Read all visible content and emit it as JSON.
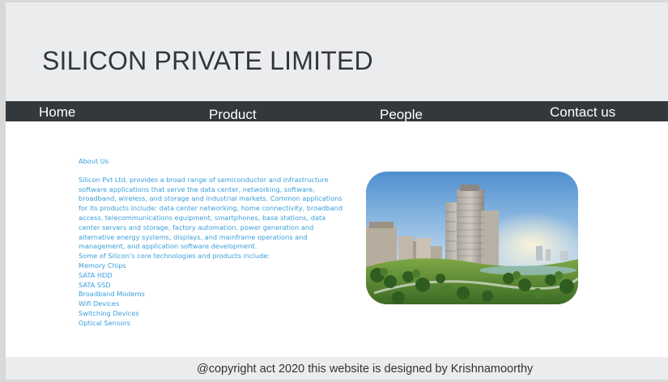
{
  "header": {
    "title": "SILICON PRIVATE LIMITED"
  },
  "nav": {
    "home": "Home",
    "product": "Product",
    "people": "People",
    "contact": "Contact us"
  },
  "about": {
    "title": "About Us",
    "description": "Silicon Pvt Ltd, provides a broad range of semiconductor and infrastructure software applications that serve the data center, networking, software, broadband, wireless, and storage and industrial markets. Common applications for its products include: data center networking, home connectivity, broadband access, telecommunications equipment, smartphones, base stations, data center servers and storage, factory automation, power generation and alternative energy systems, displays, and mainframe operations and management, and application software development.",
    "tech_intro": "Some of Silicon's core technologies and products include:",
    "technologies": [
      "Memory Chips",
      "SATA HDD",
      "SATA SSD",
      "Broadband Modems",
      "Wifi Devices",
      "Switching Devices",
      "Optical Sensors"
    ]
  },
  "image": {
    "subject": "residential high-rise buildings with green park"
  },
  "footer": {
    "copyright": "@copyright act 2020 this website is designed by Krishnamoorthy"
  },
  "colors": {
    "header_bg": "#ebecee",
    "nav_bg": "#33383c",
    "nav_text": "#ffffff",
    "body_link": "#3a9fdc",
    "footer_bg": "#ebecee"
  }
}
